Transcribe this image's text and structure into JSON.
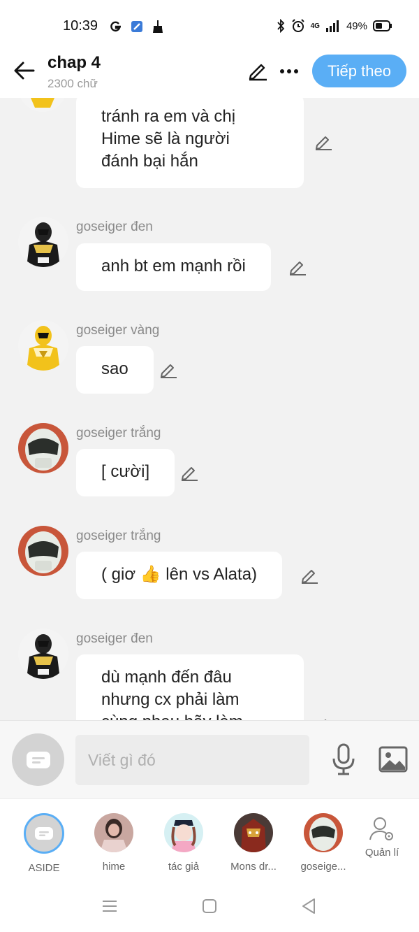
{
  "status_bar": {
    "time": "10:39",
    "network": "4G",
    "battery": "49%"
  },
  "header": {
    "title": "chap 4",
    "word_count": "2300 chữ",
    "next_label": "Tiếp theo"
  },
  "messages": [
    {
      "sender": "",
      "lines": [
        "tránh ra em và chị",
        "Hime  sẽ là người",
        "đánh bại hắn"
      ],
      "avatar": "yellow-ranger"
    },
    {
      "sender": "goseiger đen",
      "lines": [
        "anh bt em mạnh rồi"
      ],
      "avatar": "black-ranger"
    },
    {
      "sender": "goseiger vàng",
      "lines": [
        "sao"
      ],
      "avatar": "yellow-ranger"
    },
    {
      "sender": "goseiger trắng",
      "lines": [
        "[ cười]"
      ],
      "avatar": "white-ranger"
    },
    {
      "sender": "goseiger trắng",
      "lines": [
        "( giơ 👍 lên vs Alata)"
      ],
      "avatar": "white-ranger"
    },
    {
      "sender": "goseiger đen",
      "lines": [
        "dù mạnh đến đâu",
        "nhưng cx phải làm",
        "cùng nhau hãy làm"
      ],
      "avatar": "black-ranger"
    }
  ],
  "input": {
    "placeholder": "Viết gì đó"
  },
  "characters": [
    {
      "name": "ASIDE"
    },
    {
      "name": "hime"
    },
    {
      "name": "tác giả"
    },
    {
      "name": "Mons dr..."
    },
    {
      "name": "goseige..."
    }
  ],
  "manage_label": "Quản lí",
  "colors": {
    "accent": "#5aaef5",
    "background": "#f2f2f2",
    "bubble": "#ffffff"
  }
}
